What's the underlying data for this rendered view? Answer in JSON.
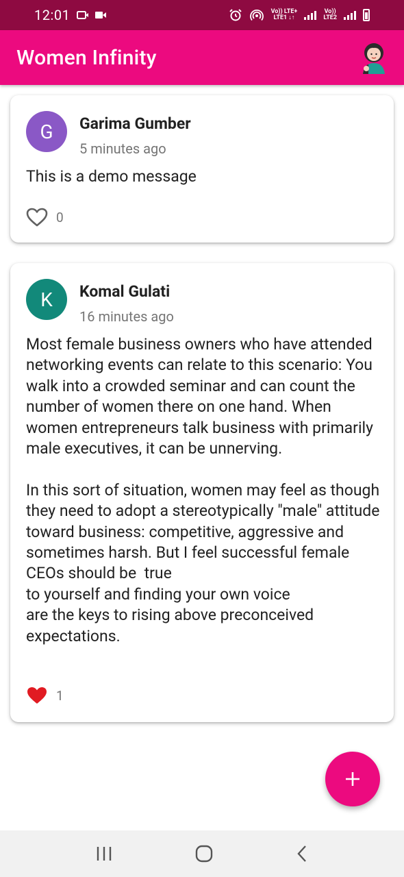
{
  "status_bar": {
    "time": "12:01",
    "sim1_label_top": "Vo)) LTE+",
    "sim1_label_bottom": "LTE1 ↓↑",
    "sim2_label_top": "Vo))",
    "sim2_label_bottom": "LTE2"
  },
  "app_bar": {
    "title": "Women Infinity",
    "profile_icon": "woman-avatar-icon"
  },
  "posts": [
    {
      "avatar_letter": "G",
      "avatar_color": "#8a58c6",
      "author": "Garima Gumber",
      "time_ago": "5 minutes ago",
      "message": "This is a demo message",
      "liked": false,
      "like_count": "0"
    },
    {
      "avatar_letter": "K",
      "avatar_color": "#12897a",
      "author": "Komal Gulati",
      "time_ago": "16 minutes ago",
      "message": "Most female business owners who have attended networking events can relate to this scenario: You walk into a crowded seminar and can count the number of women there on one hand. When women entrepreneurs talk business with primarily male executives, it can be unnerving.\n\nIn this sort of situation, women may feel as though they need to adopt a stereotypically \"male\" attitude toward business: competitive, aggressive and sometimes harsh. But I feel successful female CEOs should be  true\nto yourself and finding your own voice\nare the keys to rising above preconceived expectations.",
      "liked": true,
      "like_count": "1"
    }
  ],
  "fab": {
    "icon": "plus-icon"
  },
  "colors": {
    "status_bar": "#8e0a41",
    "app_bar": "#ec0a7f",
    "like_active": "#e11b22"
  },
  "nav_bar": {
    "icons": [
      "recent-apps-icon",
      "home-icon",
      "back-icon"
    ]
  }
}
